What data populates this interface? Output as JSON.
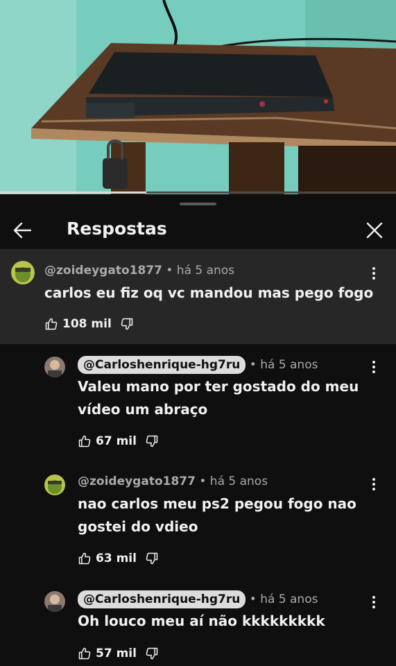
{
  "video": {
    "progress_fraction": 0.37
  },
  "panel": {
    "title": "Respostas"
  },
  "comments": [
    {
      "author": "@zoideygato1877",
      "time": "há 5 anos",
      "text": "carlos eu fiz oq vc mandou mas pego fogo",
      "likes": "108 mil"
    },
    {
      "author": "@Carloshenrique-hg7ru",
      "time": "há 5 anos",
      "text_line1": "Valeu mano por ter gostado do meu",
      "text_line2": "vídeo um abraço",
      "likes": "67 mil"
    },
    {
      "author": "@zoideygato1877",
      "time": "há 5 anos",
      "text_line1": "nao carlos meu ps2 pegou fogo nao",
      "text_line2": "gostei do vdieo",
      "likes": "63 mil"
    },
    {
      "author": "@Carloshenrique-hg7ru",
      "time": "há 5 anos",
      "text": "Oh louco meu aí não kkkkkkkkk",
      "likes": "57 mil"
    }
  ],
  "meta_separator": "•",
  "icons": {
    "back": "arrow-left-icon",
    "close": "close-icon",
    "like": "thumb-up-icon",
    "dislike": "thumb-down-icon",
    "more": "more-vert-icon"
  }
}
